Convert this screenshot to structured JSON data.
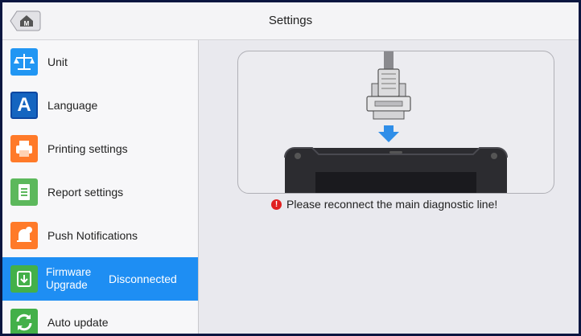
{
  "header": {
    "title": "Settings",
    "home_icon": "home-icon"
  },
  "sidebar": {
    "items": [
      {
        "label": "Unit",
        "icon": "scale-icon",
        "color": "#2196f3"
      },
      {
        "label": "Language",
        "icon": "language-icon",
        "color": "#1565c0"
      },
      {
        "label": "Printing settings",
        "icon": "printer-icon",
        "color": "#ff7a29"
      },
      {
        "label": "Report settings",
        "icon": "report-icon",
        "color": "#5cb85c"
      },
      {
        "label": "Push Notifications",
        "icon": "bell-icon",
        "color": "#ff7a29"
      },
      {
        "label": "Firmware Upgrade",
        "status": "Disconnected",
        "icon": "firmware-icon",
        "color": "#43b049",
        "active": true
      },
      {
        "label": "Auto update",
        "icon": "refresh-icon",
        "color": "#43b049"
      }
    ]
  },
  "main": {
    "message": "Please reconnect the main diagnostic line!",
    "warning_icon": "warning-icon",
    "illustration": "diagnostic-cable-illustration"
  },
  "colors": {
    "accent": "#1e8ef3",
    "warning": "#e02020"
  }
}
